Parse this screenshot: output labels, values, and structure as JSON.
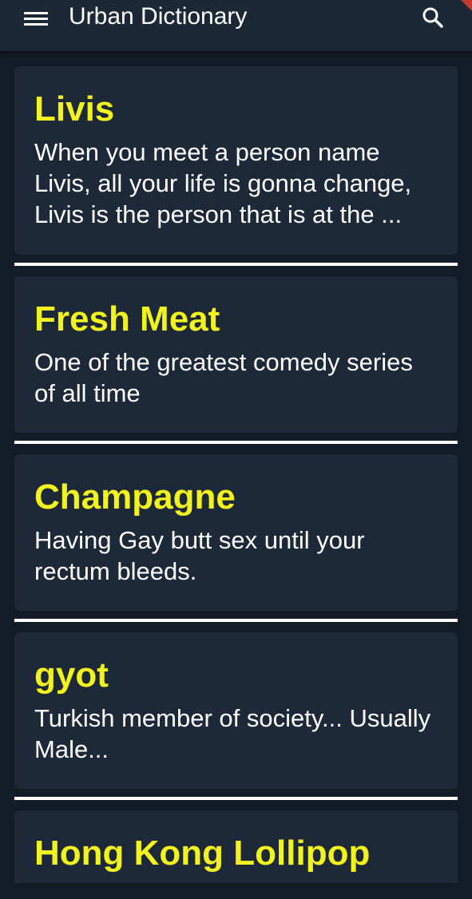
{
  "app": {
    "title": "Urban Dictionary",
    "menu_icon": "hamburger-menu-icon",
    "search_icon": "search-icon"
  },
  "colors": {
    "background": "#131b26",
    "appbar": "#1c2836",
    "card": "#1d2938",
    "word": "#f2f21c",
    "definition": "#ffffff",
    "divider": "#ffffff"
  },
  "entries": [
    {
      "word": "Livis",
      "definition": "When you meet a person name Livis, all your life is gonna change, Livis is the person that is at the ..."
    },
    {
      "word": "Fresh Meat",
      "definition": "One of the greatest comedy series of all time"
    },
    {
      "word": "Champagne",
      "definition": "Having Gay butt sex until your rectum bleeds."
    },
    {
      "word": "gyot",
      "definition": "Turkish member of society... Usually Male..."
    },
    {
      "word": "Hong Kong Lollipop",
      "definition": ""
    }
  ]
}
